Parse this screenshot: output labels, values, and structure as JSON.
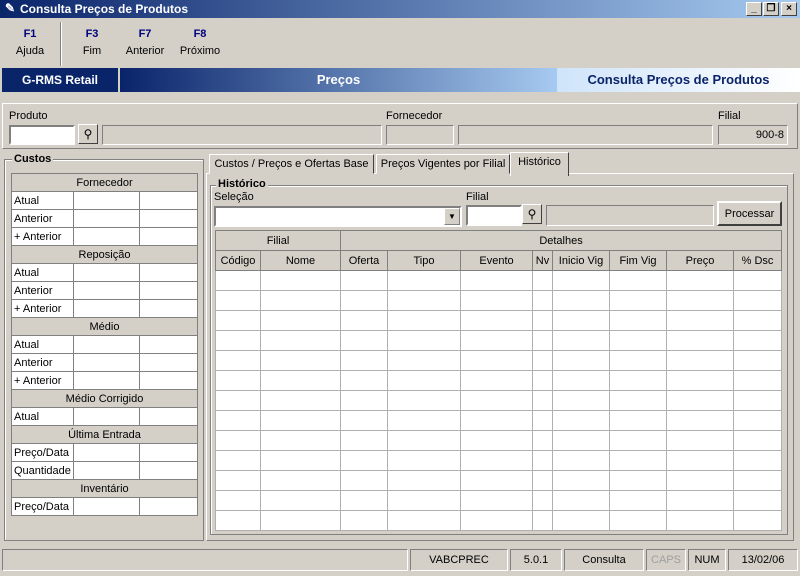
{
  "window": {
    "title": "Consulta Preços de Produtos"
  },
  "function_keys": [
    {
      "key": "F1",
      "label": "Ajuda"
    },
    {
      "key": "F3",
      "label": "Fim"
    },
    {
      "key": "F7",
      "label": "Anterior"
    },
    {
      "key": "F8",
      "label": "Próximo"
    }
  ],
  "header": {
    "brand": "G-RMS Retail",
    "module": "Preços",
    "screen": "Consulta Preços de Produtos"
  },
  "filters": {
    "produto_label": "Produto",
    "produto_value": "",
    "fornecedor_label": "Fornecedor",
    "filial_label": "Filial",
    "filial_value": "900-8"
  },
  "costs": {
    "title": "Custos",
    "sections": [
      {
        "name": "Fornecedor",
        "rows": [
          "Atual",
          "Anterior",
          "+ Anterior"
        ]
      },
      {
        "name": "Reposição",
        "rows": [
          "Atual",
          "Anterior",
          "+ Anterior"
        ]
      },
      {
        "name": "Médio",
        "rows": [
          "Atual",
          "Anterior",
          "+ Anterior"
        ]
      },
      {
        "name": "Médio Corrigido",
        "rows": [
          "Atual"
        ]
      },
      {
        "name": "Última Entrada",
        "rows": [
          "Preço/Data",
          "Quantidade"
        ]
      },
      {
        "name": "Inventário",
        "rows": [
          "Preço/Data"
        ]
      }
    ]
  },
  "tabs": [
    {
      "label": "Custos / Preços e Ofertas Base",
      "active": false
    },
    {
      "label": "Preços Vigentes por Filial",
      "active": false
    },
    {
      "label": "Histórico",
      "active": true
    }
  ],
  "historico": {
    "title": "Histórico",
    "selecao_label": "Seleção",
    "selecao_value": "",
    "filial_label": "Filial",
    "filial_value": "",
    "process_button": "Processar",
    "group_headers": [
      "Filial",
      "Detalhes"
    ],
    "columns": [
      "Código",
      "Nome",
      "Oferta",
      "Tipo",
      "Evento",
      "Nv",
      "Inicio Vig",
      "Fim Vig",
      "Preço",
      "% Dsc"
    ],
    "empty_rows": 13
  },
  "status": {
    "program": "VABCPREC",
    "version": "5.0.1",
    "mode": "Consulta",
    "caps": "CAPS",
    "num": "NUM",
    "date": "13/02/06"
  }
}
